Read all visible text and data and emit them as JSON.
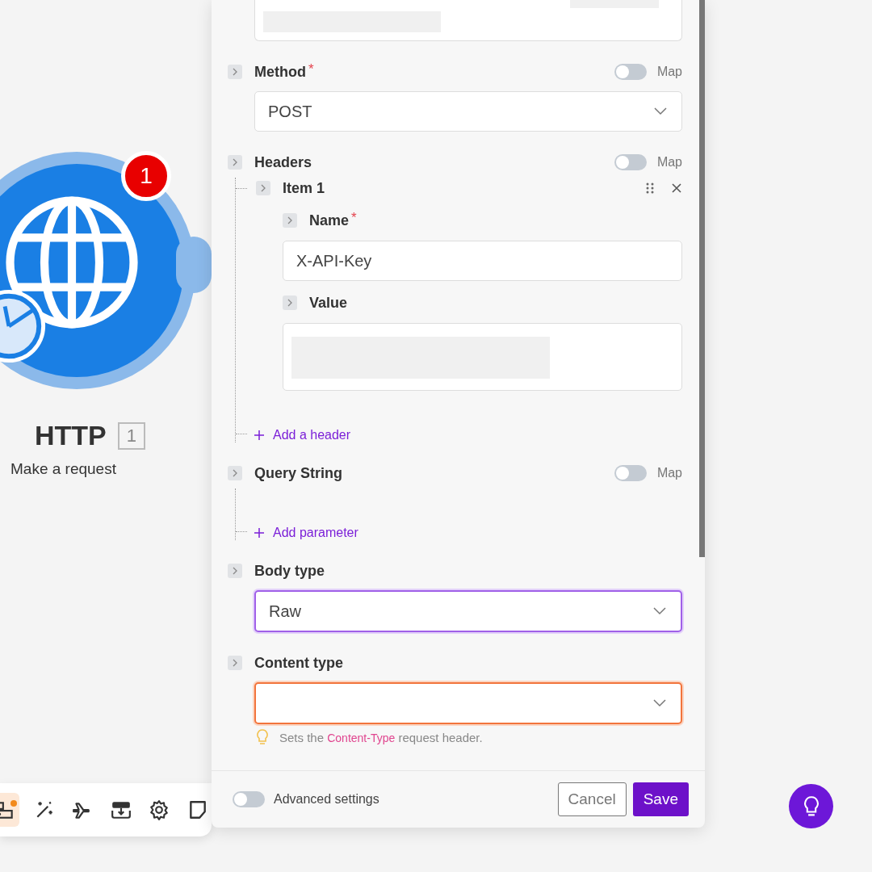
{
  "module": {
    "title": "HTTP",
    "number": "1",
    "subtitle": "Make a request",
    "badge": "1"
  },
  "toolbar": [
    {
      "selected": true,
      "alert": true
    },
    {
      "selected": false
    },
    {
      "selected": false
    },
    {
      "selected": false
    },
    {
      "selected": false
    },
    {
      "selected": false
    }
  ],
  "fields": [
    {
      "kind": "select",
      "label": "Method",
      "required_mark": "*",
      "map": {
        "on": false,
        "label": "Map"
      },
      "value": "POST",
      "focused": false,
      "invalid": false
    },
    {
      "kind": "array",
      "label": "Headers",
      "map": {
        "on": false,
        "label": "Map"
      },
      "items": [
        {
          "label": "Item 1",
          "fields": [
            {
              "kind": "input",
              "label": "Name",
              "required_mark": "*",
              "value": "X-API-Key"
            },
            {
              "kind": "textarea",
              "label": "Value"
            }
          ]
        }
      ],
      "add_label": "Add a header"
    },
    {
      "kind": "array",
      "label": "Query String",
      "map": {
        "on": false,
        "label": "Map"
      },
      "add_label": "Add parameter"
    },
    {
      "kind": "select",
      "label": "Body type",
      "value": "Raw",
      "focused": true,
      "invalid": false
    },
    {
      "kind": "select",
      "label": "Content type",
      "focused": false,
      "invalid": true,
      "hint": "Sets the **Content-Type** request header."
    }
  ],
  "footer": {
    "advanced": {
      "label": "Advanced settings",
      "on": false
    },
    "cancel": "Cancel",
    "save": "Save"
  }
}
